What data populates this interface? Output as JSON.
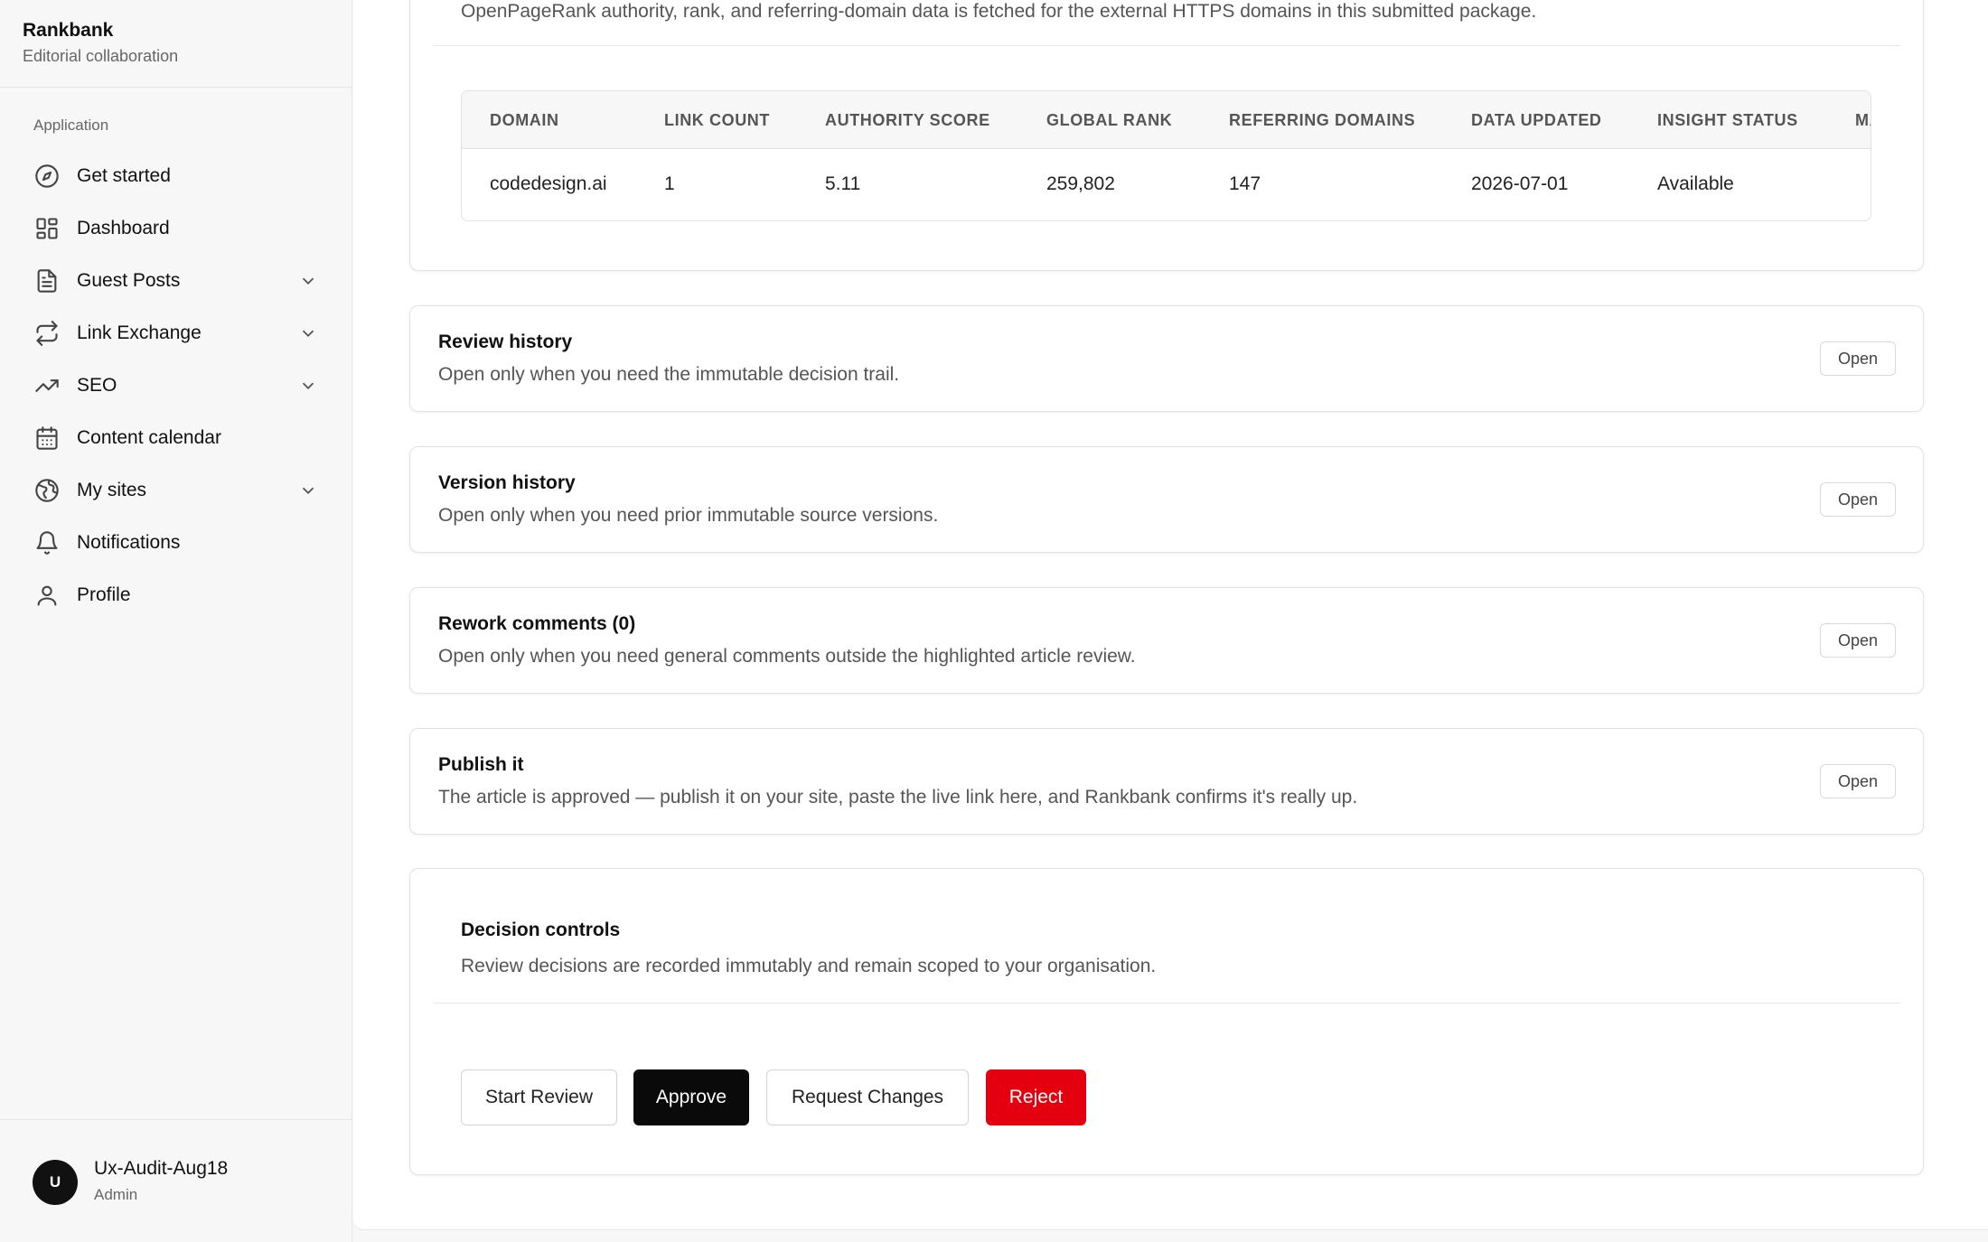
{
  "brand": {
    "name": "Rankbank",
    "subtitle": "Editorial collaboration"
  },
  "sidebar": {
    "section_label": "Application",
    "items": [
      {
        "label": "Get started",
        "icon": "compass-icon",
        "has_chevron": false
      },
      {
        "label": "Dashboard",
        "icon": "grid-icon",
        "has_chevron": false
      },
      {
        "label": "Guest Posts",
        "icon": "document-icon",
        "has_chevron": true
      },
      {
        "label": "Link Exchange",
        "icon": "repeat-icon",
        "has_chevron": true
      },
      {
        "label": "SEO",
        "icon": "trending-up-icon",
        "has_chevron": true
      },
      {
        "label": "Content calendar",
        "icon": "calendar-icon",
        "has_chevron": false
      },
      {
        "label": "My sites",
        "icon": "globe-icon",
        "has_chevron": true
      },
      {
        "label": "Notifications",
        "icon": "bell-icon",
        "has_chevron": false
      },
      {
        "label": "Profile",
        "icon": "user-icon",
        "has_chevron": false
      }
    ],
    "user": {
      "initial": "U",
      "name": "Ux-Audit-Aug18",
      "role": "Admin"
    }
  },
  "domains_panel": {
    "description": "OpenPageRank authority, rank, and referring-domain data is fetched for the external HTTPS domains in this submitted package.",
    "columns": [
      "DOMAIN",
      "LINK COUNT",
      "AUTHORITY SCORE",
      "GLOBAL RANK",
      "REFERRING DOMAINS",
      "DATA UPDATED",
      "INSIGHT STATUS",
      "MA"
    ],
    "rows": [
      [
        "codedesign.ai",
        "1",
        "5.11",
        "259,802",
        "147",
        "2026-07-01",
        "Available"
      ]
    ]
  },
  "accordions": [
    {
      "title": "Review history",
      "description": "Open only when you need the immutable decision trail.",
      "button": "Open"
    },
    {
      "title": "Version history",
      "description": "Open only when you need prior immutable source versions.",
      "button": "Open"
    },
    {
      "title": "Rework comments (0)",
      "description": "Open only when you need general comments outside the highlighted article review.",
      "button": "Open"
    },
    {
      "title": "Publish it",
      "description": "The article is approved — publish it on your site, paste the live link here, and Rankbank confirms it's really up.",
      "button": "Open"
    }
  ],
  "decision": {
    "title": "Decision controls",
    "description": "Review decisions are recorded immutably and remain scoped to your organisation.",
    "buttons": {
      "start_review": "Start Review",
      "approve": "Approve",
      "request_changes": "Request Changes",
      "reject": "Reject"
    }
  },
  "colors": {
    "reject": "#e4000f",
    "approve": "#0a0a0a"
  }
}
